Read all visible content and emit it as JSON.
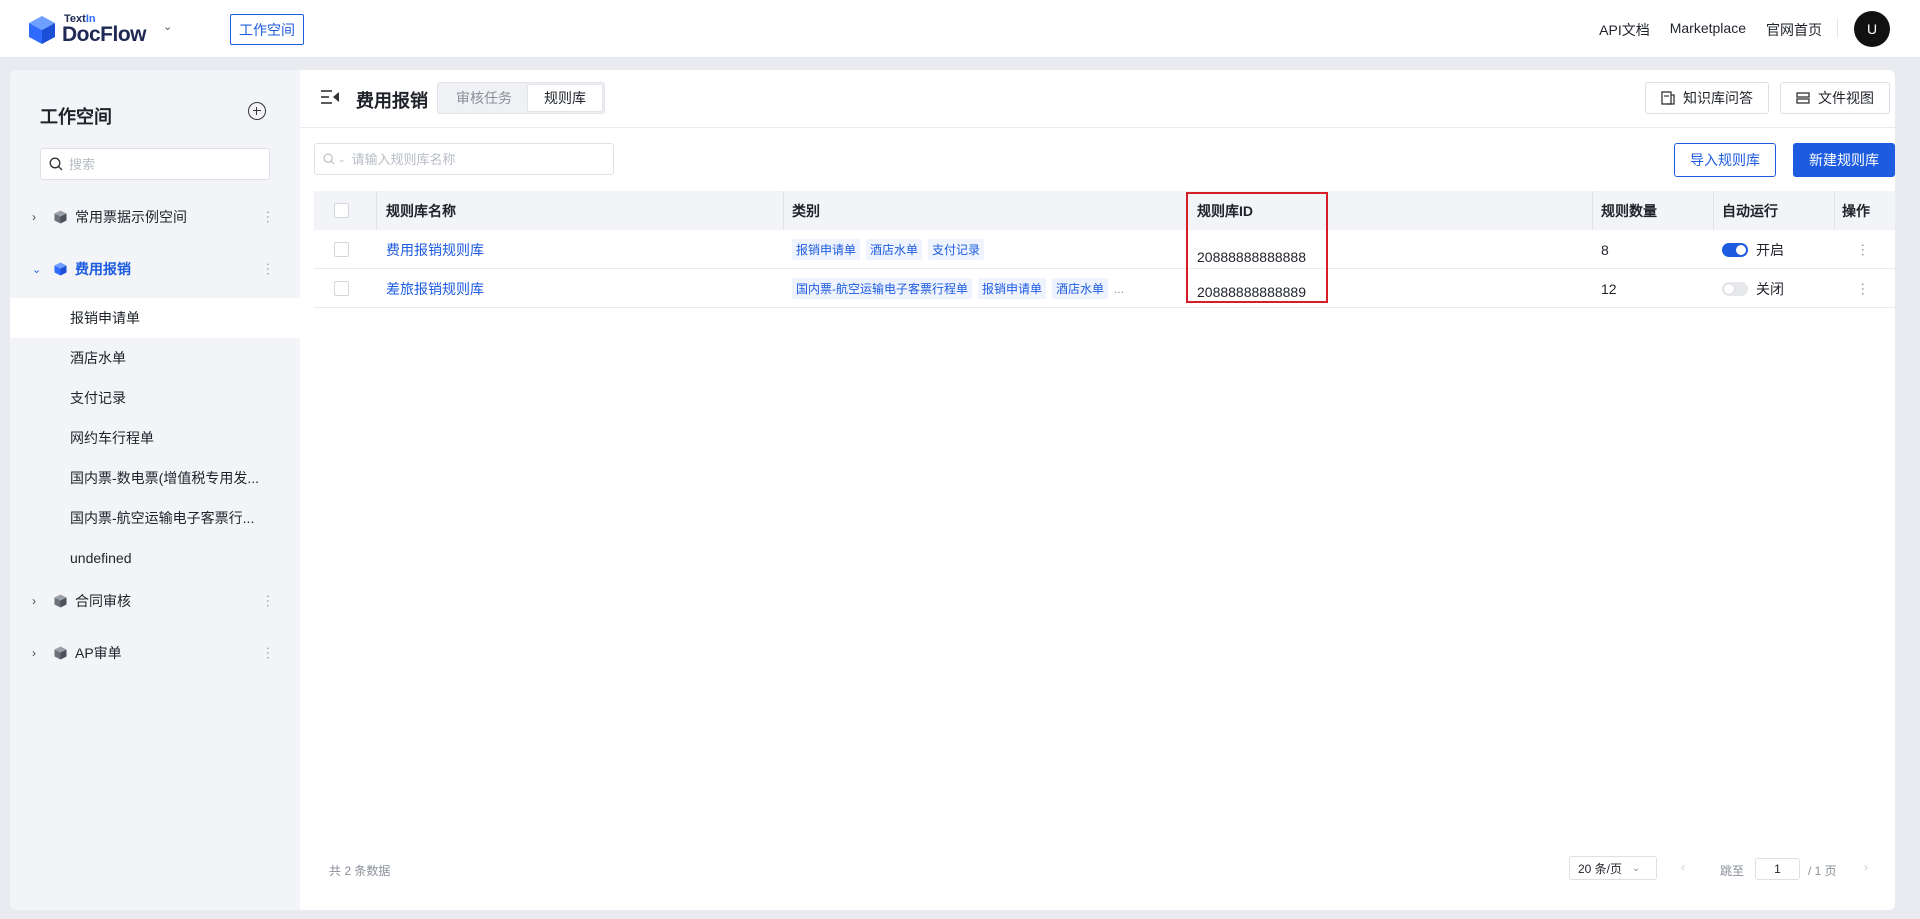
{
  "topbar": {
    "logo_small": "TextIn",
    "logo_small_a": "Text",
    "logo_small_b": "In",
    "logo_big": "DocFlow",
    "workspace_button": "工作空间",
    "links": [
      "API文档",
      "Marketplace",
      "官网首页"
    ],
    "avatar_letter": "U"
  },
  "sidebar": {
    "title": "工作空间",
    "search_placeholder": "搜索",
    "spaces": [
      {
        "label": "常用票据示例空间",
        "expanded": false
      },
      {
        "label": "费用报销",
        "expanded": true
      },
      {
        "label": "合同审核",
        "expanded": false
      },
      {
        "label": "AP审单",
        "expanded": false
      }
    ],
    "sub_items": [
      "报销申请单",
      "酒店水单",
      "支付记录",
      "网约车行程单",
      "国内票-数电票(增值税专用发...",
      "国内票-航空运输电子客票行...",
      "undefined"
    ]
  },
  "main": {
    "title": "费用报销",
    "tabs": [
      "审核任务",
      "规则库"
    ],
    "active_tab": "规则库",
    "header_buttons": {
      "kb_qa": "知识库问答",
      "file_view": "文件视图"
    },
    "search_placeholder": "请输入规则库名称",
    "import_button": "导入规则库",
    "new_button": "新建规则库",
    "columns": [
      "规则库名称",
      "类别",
      "规则库ID",
      "规则数量",
      "自动运行",
      "操作"
    ],
    "rows": [
      {
        "name": "费用报销规则库",
        "categories": [
          "报销申请单",
          "酒店水单",
          "支付记录"
        ],
        "more": "",
        "id": "20888888888888",
        "rule_count": "8",
        "auto_run": true,
        "auto_label": "开启"
      },
      {
        "name": "差旅报销规则库",
        "categories": [
          "国内票-航空运输电子客票行程单",
          "报销申请单",
          "酒店水单"
        ],
        "more": "...",
        "id": "20888888888889",
        "rule_count": "12",
        "auto_run": false,
        "auto_label": "关闭"
      }
    ],
    "footer": {
      "total": "共 2 条数据",
      "page_size": "20 条/页",
      "jump_label": "跳至",
      "current_page": "1",
      "page_total": "/ 1 页"
    }
  },
  "colors": {
    "accent": "#1d5ce0",
    "highlight": "#d51f28"
  }
}
